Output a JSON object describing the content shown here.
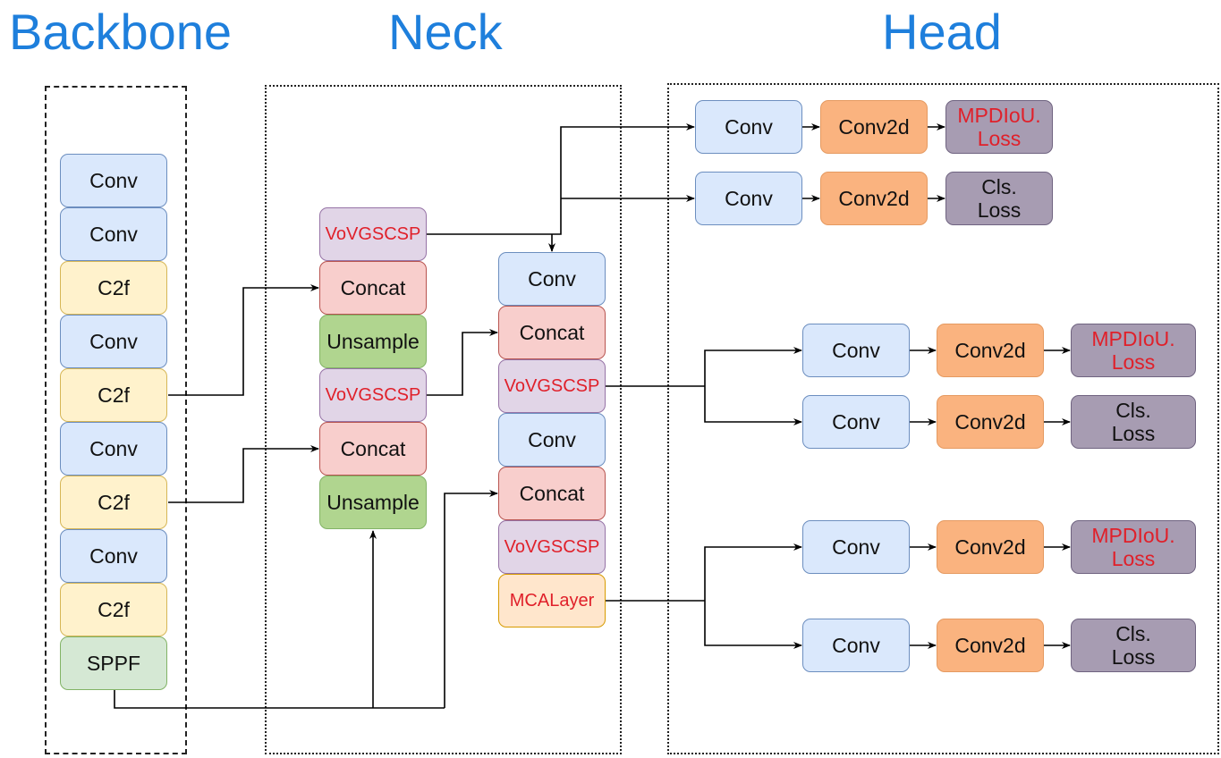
{
  "sections": {
    "backbone": "Backbone",
    "neck": "Neck",
    "head": "Head"
  },
  "colors": {
    "title": "#1e7fdc",
    "highlight_text": "#e0202a"
  },
  "backbone": {
    "layers": [
      "Conv",
      "Conv",
      "C2f",
      "Conv",
      "C2f",
      "Conv",
      "C2f",
      "Conv",
      "C2f",
      "SPPF"
    ]
  },
  "neck": {
    "column1": [
      "VoVGSCSP",
      "Concat",
      "Unsample",
      "VoVGSCSP",
      "Concat",
      "Unsample"
    ],
    "column2": [
      "Conv",
      "Concat",
      "VoVGSCSP",
      "Conv",
      "Concat",
      "VoVGSCSP",
      "MCALayer"
    ]
  },
  "head": {
    "groups": [
      {
        "rows": [
          {
            "conv": "Conv",
            "conv2d": "Conv2d",
            "loss": "MPDIoU.\nLoss",
            "loss_line1": "MPDIoU.",
            "loss_line2": "Loss"
          },
          {
            "conv": "Conv",
            "conv2d": "Conv2d",
            "loss": "Cls.\nLoss",
            "loss_line1": "Cls.",
            "loss_line2": "Loss"
          }
        ]
      },
      {
        "rows": [
          {
            "conv": "Conv",
            "conv2d": "Conv2d",
            "loss_line1": "MPDIoU.",
            "loss_line2": "Loss"
          },
          {
            "conv": "Conv",
            "conv2d": "Conv2d",
            "loss_line1": "Cls.",
            "loss_line2": "Loss"
          }
        ]
      },
      {
        "rows": [
          {
            "conv": "Conv",
            "conv2d": "Conv2d",
            "loss_line1": "MPDIoU.",
            "loss_line2": "Loss"
          },
          {
            "conv": "Conv",
            "conv2d": "Conv2d",
            "loss_line1": "Cls.",
            "loss_line2": "Loss"
          }
        ]
      }
    ]
  }
}
